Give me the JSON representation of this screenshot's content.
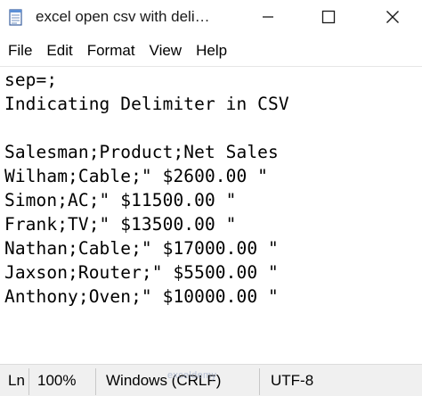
{
  "window": {
    "title": "excel open csv with deli…",
    "app_icon": "notepad-icon",
    "controls": {
      "minimize_icon": "minimize-icon",
      "maximize_icon": "maximize-icon",
      "close_icon": "close-icon"
    }
  },
  "menu": {
    "items": [
      "File",
      "Edit",
      "Format",
      "View",
      "Help"
    ]
  },
  "editor": {
    "lines": [
      "sep=;",
      "Indicating Delimiter in CSV",
      "",
      "Salesman;Product;Net Sales",
      "Wilham;Cable;\" $2600.00 \"",
      "Simon;AC;\" $11500.00 \"",
      "Frank;TV;\" $13500.00 \"",
      "Nathan;Cable;\" $17000.00 \"",
      "Jaxson;Router;\" $5500.00 \"",
      "Anthony;Oven;\" $10000.00 \""
    ]
  },
  "status": {
    "position": "Ln",
    "zoom": "100%",
    "line_ending": "Windows (CRLF)",
    "encoding": "UTF-8",
    "watermark": "exceldemy"
  },
  "colors": {
    "background": "#ffffff",
    "statusbar": "#f0f0f0"
  }
}
